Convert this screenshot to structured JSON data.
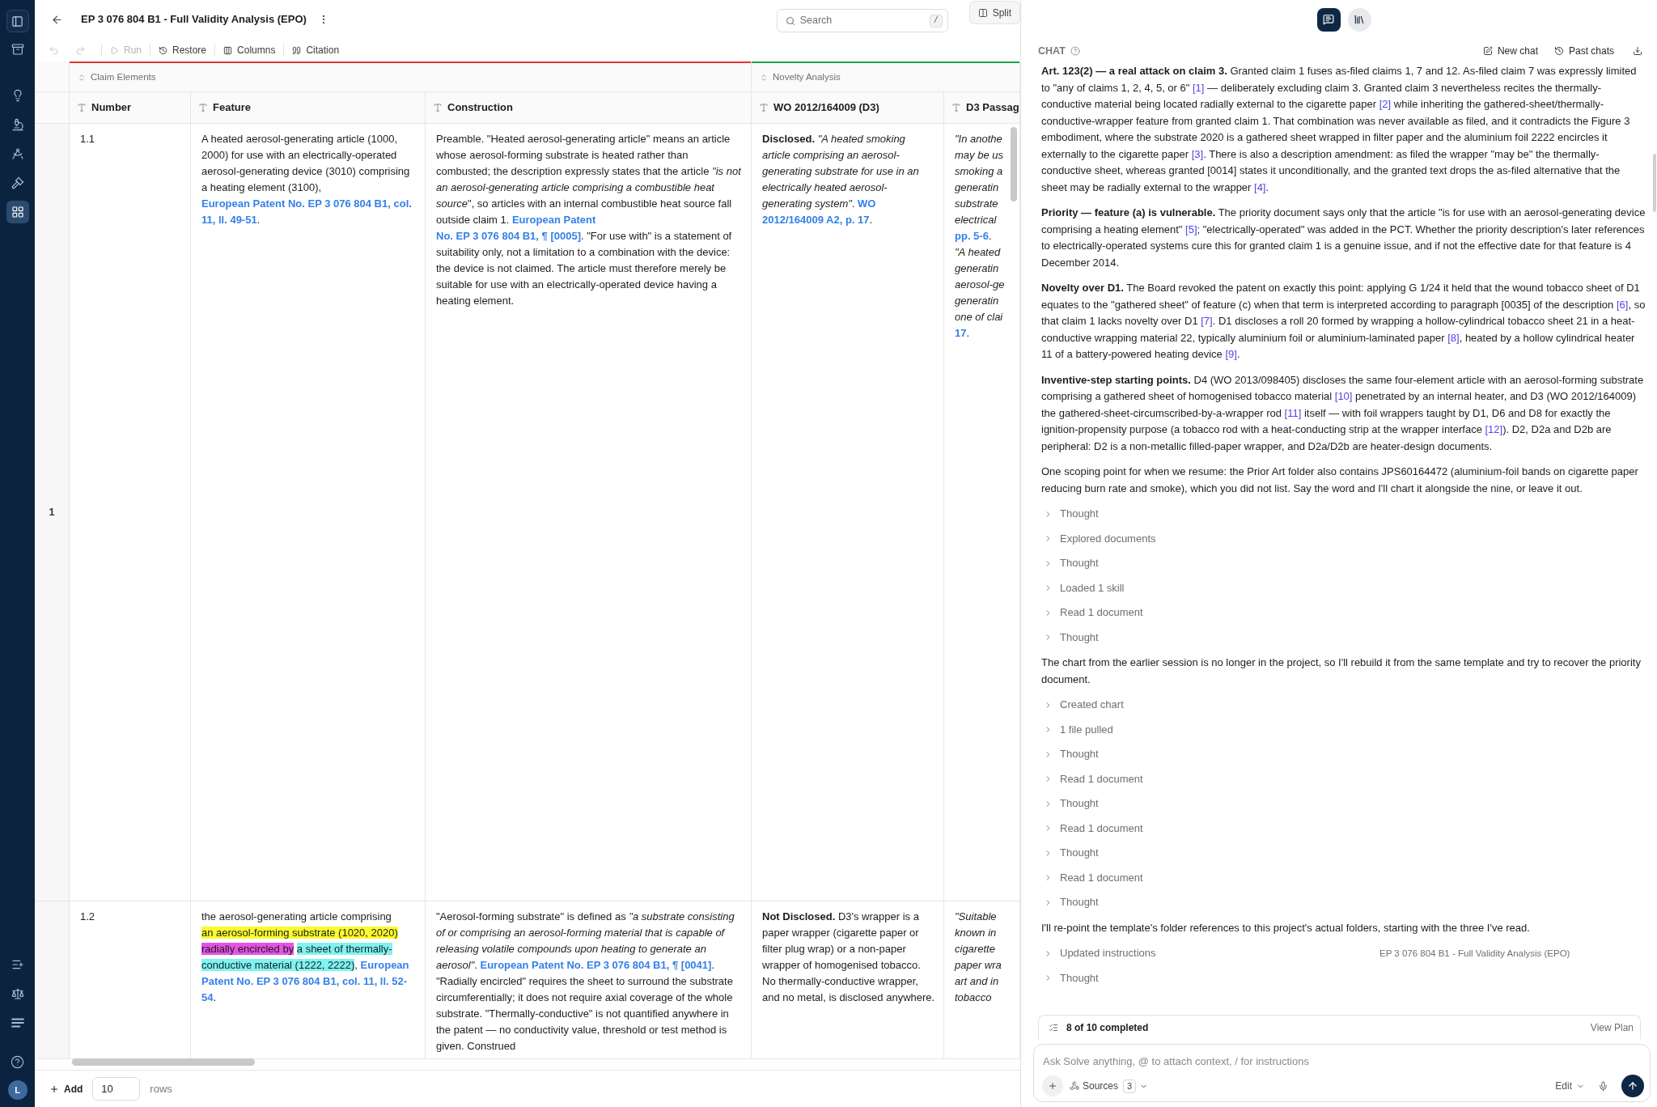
{
  "nav_top": [
    {
      "selected": false
    },
    {
      "selected": false
    },
    {
      "selected": false
    },
    {
      "selected": false
    },
    {
      "selected": false
    },
    {
      "selected": true
    }
  ],
  "nav_bottom": [
    {
      "selected": false
    },
    {
      "selected": false
    },
    {
      "selected": false
    }
  ],
  "user": {
    "initial": "L"
  },
  "document": {
    "title": "EP 3 076 804 B1 - Full Validity Analysis (EPO)",
    "search": {
      "placeholder": "Search",
      "shortcut": "/"
    },
    "split": "Split"
  },
  "toolbar": {
    "history": [
      {
        "disabled": true
      },
      {
        "disabled": true
      }
    ],
    "actions": [
      {
        "label": "Run",
        "disabled": true
      },
      {
        "label": "Restore",
        "disabled": false
      },
      {
        "label": "Columns",
        "disabled": false
      },
      {
        "label": "Citation",
        "disabled": false
      }
    ]
  },
  "table": {
    "groups": [
      {
        "label": "Claim Elements",
        "color": "#e0342f",
        "columns": [
          "Number",
          "Feature",
          "Construction"
        ]
      },
      {
        "label": "Novelty Analysis",
        "color": "#1ea34a",
        "columns": [
          "WO 2012/164009 (D3)",
          "D3 Passag"
        ]
      }
    ],
    "rows": [
      {
        "row_number": "1",
        "cells": [
          {
            "segments": [
              {
                "kind": "text",
                "text": "1.1"
              }
            ]
          },
          {
            "segments": [
              {
                "kind": "text",
                "text": "A heated aerosol-generating article (1000, 2000) for use with an electrically-operated aerosol-generating device (3010) comprising a heating element (3100), "
              },
              {
                "kind": "link",
                "parts": [
                  "European Patent No. EP 3 076 804 B1, col. ",
                  "11, ll. 49-51"
                ]
              },
              {
                "kind": "text",
                "text": "."
              }
            ]
          },
          {
            "segments": [
              {
                "kind": "text",
                "text": "Preamble. \"Heated aerosol-generating article\" means an article whose aerosol-forming substrate is heated rather than combusted; the description expressly states that the article "
              },
              {
                "kind": "italic",
                "text": "\"is not an aerosol-generating article comprising a combustible heat source"
              },
              {
                "kind": "text",
                "text": "\", so articles with an internal combustible heat source fall outside claim 1. "
              },
              {
                "kind": "link",
                "parts": [
                  "European Patent ",
                  "No. EP 3 076 804 B1, ¶ [0005]"
                ]
              },
              {
                "kind": "text",
                "text": ". \"For use with\" is a statement of suitability only, not a limitation to a combination with the device: the device is not claimed. The article must therefore merely be suitable for use with an electrically-operated device having a heating element."
              }
            ]
          },
          {
            "segments": [
              {
                "kind": "bold",
                "text": "Disclosed. "
              },
              {
                "kind": "italic",
                "text": "\"A heated smoking article comprising an aerosol-generating substrate for use in an electrically heated aerosol-generating system\""
              },
              {
                "kind": "text",
                "text": ". "
              },
              {
                "kind": "link",
                "parts": [
                  "WO ",
                  "2012/164009 A2, p. 17"
                ]
              },
              {
                "kind": "text",
                "text": "."
              }
            ]
          },
          {
            "lines": [
              {
                "segments": [
                  {
                    "kind": "italic",
                    "text": "\"In anothe"
                  }
                ]
              },
              {
                "segments": [
                  {
                    "kind": "italic",
                    "text": "may be us"
                  }
                ]
              },
              {
                "segments": [
                  {
                    "kind": "italic",
                    "text": "smoking a"
                  }
                ]
              },
              {
                "segments": [
                  {
                    "kind": "italic",
                    "text": "generatin"
                  }
                ]
              },
              {
                "segments": [
                  {
                    "kind": "italic",
                    "text": "substrate"
                  }
                ]
              },
              {
                "segments": [
                  {
                    "kind": "italic",
                    "text": "electrical"
                  }
                ]
              },
              {
                "segments": [
                  {
                    "kind": "link",
                    "parts": [
                      "pp. 5-6"
                    ]
                  },
                  {
                    "kind": "text",
                    "text": "."
                  }
                ]
              },
              {
                "segments": [
                  {
                    "kind": "italic",
                    "text": "\"A heated"
                  }
                ]
              },
              {
                "segments": [
                  {
                    "kind": "italic",
                    "text": "generatin"
                  }
                ]
              },
              {
                "segments": [
                  {
                    "kind": "italic",
                    "text": "aerosol-ge"
                  }
                ]
              },
              {
                "segments": [
                  {
                    "kind": "italic",
                    "text": "generatin"
                  }
                ]
              },
              {
                "segments": [
                  {
                    "kind": "italic",
                    "text": "one of clai"
                  }
                ]
              },
              {
                "segments": [
                  {
                    "kind": "link",
                    "parts": [
                      "17"
                    ]
                  },
                  {
                    "kind": "text",
                    "text": "."
                  }
                ]
              }
            ]
          }
        ]
      },
      {
        "cells": [
          {
            "segments": [
              {
                "kind": "text",
                "text": "1.2"
              }
            ]
          },
          {
            "segments": [
              {
                "kind": "text",
                "text": "the aerosol-generating article comprising "
              },
              {
                "kind": "highlights",
                "items": [
                  {
                    "color": "#fbfb2e",
                    "parts": [
                      "an aerosol-forming substrate (1020, 2020)"
                    ]
                  },
                  {
                    "color": "#e652e6",
                    "parts": [
                      "radially encircled by"
                    ]
                  },
                  {
                    "color": "#7ff3f3",
                    "parts": [
                      "a sheet of thermally-",
                      "conductive material (1222, 2222)"
                    ]
                  }
                ]
              },
              {
                "kind": "text",
                "text": ", "
              },
              {
                "kind": "link",
                "parts": [
                  "European ",
                  "Patent No. EP 3 076 804 B1, col. 11, ll. 52-",
                  "54"
                ]
              },
              {
                "kind": "text",
                "text": "."
              }
            ]
          },
          {
            "segments": [
              {
                "kind": "text",
                "text": "\"Aerosol-forming substrate\" is defined as "
              },
              {
                "kind": "italic",
                "text": "\"a substrate consisting of or comprising an aerosol-forming material that is capable of releasing volatile compounds upon heating to generate an aerosol\""
              },
              {
                "kind": "text",
                "text": ". "
              },
              {
                "kind": "link",
                "parts": [
                  "European Patent No. EP 3 076 804 B1, ",
                  "¶ [0041]"
                ]
              },
              {
                "kind": "text",
                "text": ". \"Radially encircled\" requires the sheet to surround the substrate circumferentially; it does not require axial coverage of the whole substrate. \"Thermally-conductive\" is not quantified anywhere in the patent — no conductivity value, threshold or test method is given. Construed"
              }
            ]
          },
          {
            "segments": [
              {
                "kind": "bold",
                "text": "Not Disclosed."
              },
              {
                "kind": "text",
                "text": " D3's wrapper is a paper wrapper (cigarette paper or filter plug wrap) or a non-paper wrapper of homogenised tobacco. No thermally-conductive wrapper, and no metal, is disclosed anywhere."
              }
            ]
          },
          {
            "lines": [
              {
                "segments": [
                  {
                    "kind": "italic",
                    "text": "\"Suitable"
                  }
                ]
              },
              {
                "segments": [
                  {
                    "kind": "italic",
                    "text": "known in"
                  }
                ]
              },
              {
                "segments": [
                  {
                    "kind": "italic",
                    "text": "cigarette"
                  }
                ]
              },
              {
                "segments": [
                  {
                    "kind": "italic",
                    "text": "paper wra"
                  }
                ]
              },
              {
                "segments": [
                  {
                    "kind": "italic",
                    "text": "art and in"
                  }
                ]
              },
              {
                "segments": [
                  {
                    "kind": "italic",
                    "text": "tobacco"
                  }
                ]
              }
            ]
          }
        ]
      }
    ]
  },
  "footer": {
    "add": "Add",
    "count": "10",
    "unit": "rows"
  },
  "chat": {
    "modes": [
      {
        "selected": true
      },
      {
        "selected": false
      }
    ],
    "title": "CHAT",
    "new_chat": "New chat",
    "past_chats": "Past chats",
    "messages": [
      {
        "kind": "paragraph",
        "segments": [
          {
            "kind": "bold",
            "text": "Art. 123(2) — a real attack on claim 3."
          },
          {
            "kind": "text",
            "text": " Granted claim 1 fuses as-filed claims 1, 7 and 12. As-filed claim 7 was expressly limited to \"any of claims 1, 2, 4, 5, or 6\" "
          },
          {
            "kind": "cite",
            "text": "[1]"
          },
          {
            "kind": "text",
            "text": " — deliberately excluding claim 3. Granted claim 3 nevertheless recites the thermally-conductive material being located radially external to the cigarette paper "
          },
          {
            "kind": "cite",
            "text": "[2]"
          },
          {
            "kind": "text",
            "text": " while inheriting the gathered-sheet/thermally-conductive-wrapper feature from granted claim 1. That combination was never available as filed, and it contradicts the Figure 3 embodiment, where the substrate 2020 is a gathered sheet wrapped in filter paper and the aluminium foil 2222 encircles it externally to the cigarette paper "
          },
          {
            "kind": "cite",
            "text": "[3]"
          },
          {
            "kind": "text",
            "text": ". There is also a description amendment: as filed the wrapper \"may be\" the thermally-conductive sheet, whereas granted [0014] states it unconditionally, and the granted text drops the as-filed alternative that the sheet may be radially external to the wrapper "
          },
          {
            "kind": "cite",
            "text": "[4]"
          },
          {
            "kind": "text",
            "text": "."
          }
        ]
      },
      {
        "kind": "paragraph",
        "segments": [
          {
            "kind": "bold",
            "text": "Priority — feature (a) is vulnerable."
          },
          {
            "kind": "text",
            "text": " The priority document says only that the article \"is for use with an aerosol-generating device comprising a heating element\" "
          },
          {
            "kind": "cite",
            "text": "[5]"
          },
          {
            "kind": "text",
            "text": "; \"electrically-operated\" was added in the PCT. Whether the priority description's later references to electrically-operated systems cure this for granted claim 1 is a genuine issue, and if not the effective date for that feature is 4 December 2014."
          }
        ]
      },
      {
        "kind": "paragraph",
        "segments": [
          {
            "kind": "bold",
            "text": "Novelty over D1."
          },
          {
            "kind": "text",
            "text": " The Board revoked the patent on exactly this point: applying G 1/24 it held that the wound tobacco sheet of D1 equates to the \"gathered sheet\" of feature (c) when that term is interpreted according to paragraph [0035] of the description "
          },
          {
            "kind": "cite",
            "text": "[6]"
          },
          {
            "kind": "text",
            "text": ", so that claim 1 lacks novelty over D1 "
          },
          {
            "kind": "cite",
            "text": "[7]"
          },
          {
            "kind": "text",
            "text": ". D1 discloses a roll 20 formed by wrapping a hollow-cylindrical tobacco sheet 21 in a heat-conductive wrapping material 22, typically aluminium foil or aluminium-laminated paper "
          },
          {
            "kind": "cite",
            "text": "[8]"
          },
          {
            "kind": "text",
            "text": ", heated by a hollow cylindrical heater 11 of a battery-powered heating device "
          },
          {
            "kind": "cite",
            "text": "[9]"
          },
          {
            "kind": "text",
            "text": "."
          }
        ]
      },
      {
        "kind": "paragraph",
        "segments": [
          {
            "kind": "bold",
            "text": "Inventive-step starting points."
          },
          {
            "kind": "text",
            "text": " D4 (WO 2013/098405) discloses the same four-element article with an aerosol-forming substrate comprising a gathered sheet of homogenised tobacco material "
          },
          {
            "kind": "cite",
            "text": "[10]"
          },
          {
            "kind": "text",
            "text": " penetrated by an internal heater, and D3 (WO 2012/164009) the gathered-sheet-circumscribed-by-a-wrapper rod "
          },
          {
            "kind": "cite",
            "text": "[11]"
          },
          {
            "kind": "text",
            "text": " itself — with foil wrappers taught by D1, D6 and D8 for exactly the ignition-propensity purpose (a tobacco rod with a heat-conducting strip at the wrapper interface "
          },
          {
            "kind": "cite",
            "text": "[12]"
          },
          {
            "kind": "text",
            "text": "). D2, D2a and D2b are peripheral: D2 is a non-metallic filled-paper wrapper, and D2a/D2b are heater-design documents."
          }
        ]
      },
      {
        "kind": "paragraph",
        "segments": [
          {
            "kind": "text",
            "text": "One scoping point for when we resume: the Prior Art folder also contains JPS60164472 (aluminium-foil bands on cigarette paper reducing burn rate and smoke), which you did not list. Say the word and I'll chart it alongside the nine, or leave it out."
          }
        ]
      },
      {
        "kind": "step",
        "label": "Thought",
        "expanded": false
      },
      {
        "kind": "step",
        "label": "Explored documents",
        "expanded": false
      },
      {
        "kind": "step",
        "label": "Thought",
        "expanded": false
      },
      {
        "kind": "step",
        "label": "Loaded 1 skill",
        "expanded": false
      },
      {
        "kind": "step",
        "label": "Read 1 document",
        "expanded": false
      },
      {
        "kind": "step",
        "label": "Thought",
        "expanded": false
      },
      {
        "kind": "paragraph",
        "segments": [
          {
            "kind": "text",
            "text": "The chart from the earlier session is no longer in the project, so I'll rebuild it from the same template and try to recover the priority document."
          }
        ]
      },
      {
        "kind": "step",
        "label": "Created chart",
        "expanded": false
      },
      {
        "kind": "step",
        "label": "1 file pulled",
        "expanded": false
      },
      {
        "kind": "step",
        "label": "Thought",
        "expanded": false
      },
      {
        "kind": "step",
        "label": "Read 1 document",
        "expanded": false
      },
      {
        "kind": "step",
        "label": "Thought",
        "expanded": false
      },
      {
        "kind": "step",
        "label": "Read 1 document",
        "expanded": false
      },
      {
        "kind": "step",
        "label": "Thought",
        "expanded": false
      },
      {
        "kind": "step",
        "label": "Read 1 document",
        "expanded": false
      },
      {
        "kind": "step",
        "label": "Thought",
        "expanded": false
      },
      {
        "kind": "paragraph",
        "segments": [
          {
            "kind": "text",
            "text": "I'll re-point the template's folder references to this project's actual folders, starting with the three I've read."
          }
        ]
      },
      {
        "kind": "step",
        "label": "Updated instructions",
        "expanded": false,
        "detail": "EP 3 076 804 B1 - Full Validity Analysis (EPO)"
      },
      {
        "kind": "step",
        "label": "Thought",
        "expanded": false
      }
    ],
    "plan": {
      "status": "8 of 10 completed",
      "link": "View Plan"
    },
    "composer": {
      "placeholder": "Ask Solve anything, @ to attach context, / for instructions",
      "sources": "Sources",
      "sources_count": "3",
      "mode": "Edit"
    }
  }
}
